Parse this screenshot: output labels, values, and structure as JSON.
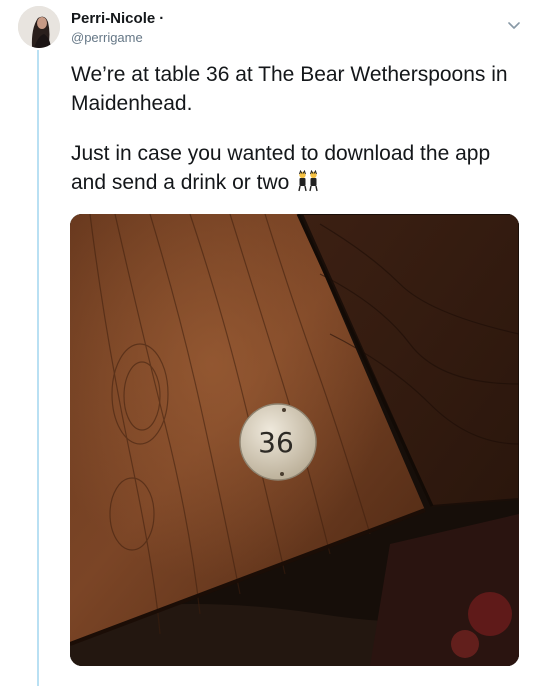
{
  "author": {
    "display_name": "Perri-Nicole",
    "separator": "·",
    "handle": "@perrigame"
  },
  "tweet": {
    "paragraphs": [
      "We’re at table 36 at The Bear Wetherspoons in Maidenhead.",
      "Just in case you wanted to download the app and send a drink or two"
    ],
    "emoji_icon": "two-women-dancing-icon"
  },
  "photo": {
    "table_marker_text": "36"
  },
  "icons": {
    "menu": "chevron-down-icon"
  },
  "colors": {
    "thread_line": "#b9e0f3",
    "handle_text": "#657786",
    "body_text": "#14171a"
  }
}
